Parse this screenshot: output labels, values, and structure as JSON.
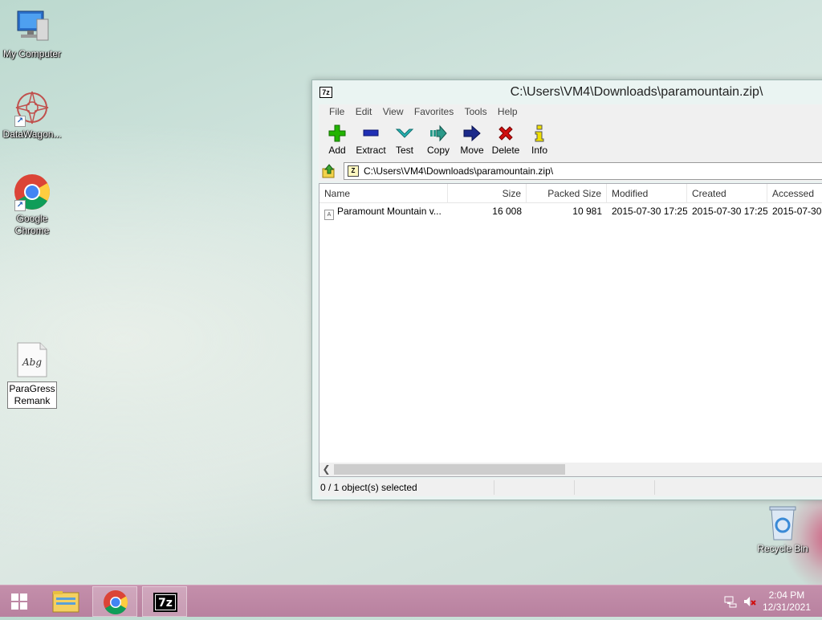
{
  "desktop": {
    "icons": [
      {
        "label": "My Computer"
      },
      {
        "label": "DataWagon..."
      },
      {
        "label": "Google Chrome"
      },
      {
        "label": "ParaGress Remank"
      }
    ],
    "recycle_bin": "Recycle Bin"
  },
  "window": {
    "title": "C:\\Users\\VM4\\Downloads\\paramountain.zip\\",
    "menu": [
      "File",
      "Edit",
      "View",
      "Favorites",
      "Tools",
      "Help"
    ],
    "toolbar": [
      {
        "label": "Add",
        "icon": "plus-icon",
        "color": "#22b400"
      },
      {
        "label": "Extract",
        "icon": "minus-icon",
        "color": "#1f2fb5"
      },
      {
        "label": "Test",
        "icon": "check-chevron-icon",
        "color": "#27a9a9"
      },
      {
        "label": "Copy",
        "icon": "copy-arrow-icon",
        "color": "#2b9a8a"
      },
      {
        "label": "Move",
        "icon": "move-arrow-icon",
        "color": "#1c2a8a"
      },
      {
        "label": "Delete",
        "icon": "x-icon",
        "color": "#d01010"
      },
      {
        "label": "Info",
        "icon": "info-icon",
        "color": "#e0d000"
      }
    ],
    "address": "C:\\Users\\VM4\\Downloads\\paramountain.zip\\",
    "columns": [
      "Name",
      "Size",
      "Packed Size",
      "Modified",
      "Created",
      "Accessed"
    ],
    "rows": [
      {
        "name": "Paramount Mountain v...",
        "size": "16 008",
        "packed": "10 981",
        "modified": "2015-07-30 17:25",
        "created": "2015-07-30 17:25",
        "accessed": "2015-07-30"
      }
    ],
    "status": "0 / 1 object(s) selected"
  },
  "taskbar": {
    "time": "2:04 PM",
    "date": "12/31/2021"
  }
}
